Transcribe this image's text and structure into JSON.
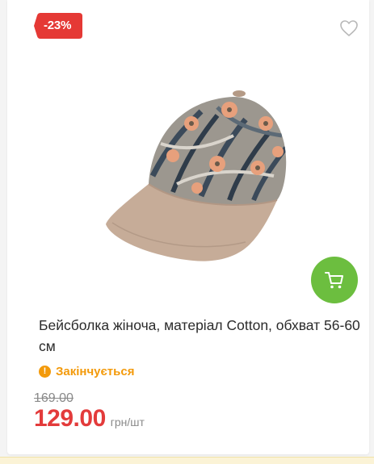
{
  "product": {
    "discount_label": "-23%",
    "title": "Бейсболка жіноча, матеріал Cotton, обхват 56-60 см",
    "stock_status": "Закінчується",
    "old_price": "169.00",
    "new_price": "129.00",
    "unit": "грн/шт"
  },
  "icons": {
    "wishlist": "heart-icon",
    "cart": "cart-icon",
    "stock": "warning-icon"
  },
  "colors": {
    "discount_bg": "#e53935",
    "cart_bg": "#6cbe3f",
    "price": "#e33b3b",
    "stock": "#f39a0b"
  }
}
